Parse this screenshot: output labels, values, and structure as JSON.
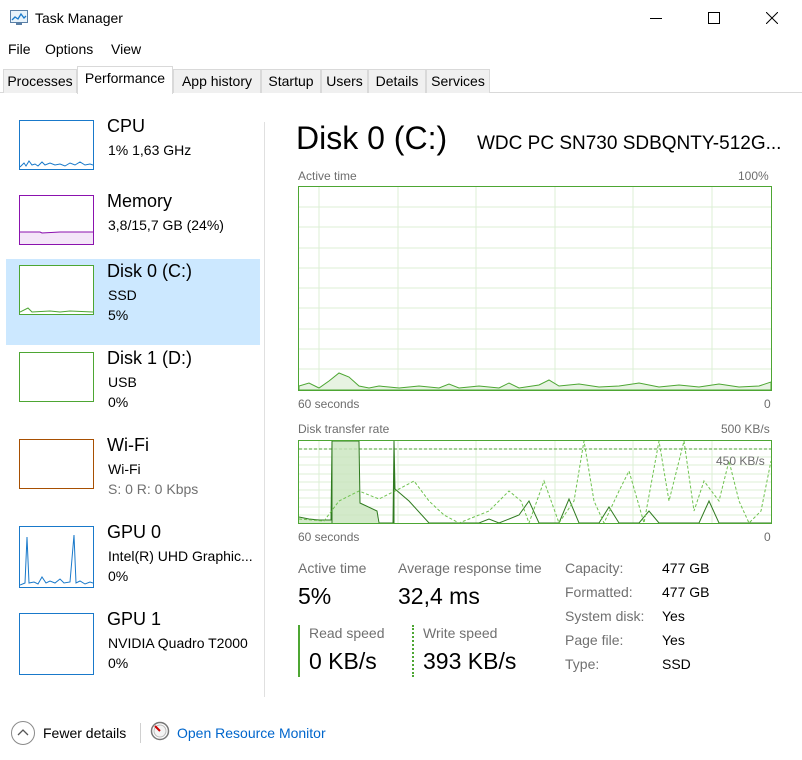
{
  "window": {
    "title": "Task Manager"
  },
  "menu": [
    "File",
    "Options",
    "View"
  ],
  "tabs": [
    "Processes",
    "Performance",
    "App history",
    "Startup",
    "Users",
    "Details",
    "Services"
  ],
  "sidebar": {
    "items": [
      {
        "name": "CPU",
        "line2": "1%  1,63 GHz",
        "line3": "",
        "color": "#1979ca"
      },
      {
        "name": "Memory",
        "line2": "3,8/15,7 GB (24%)",
        "line3": "",
        "color": "#8b12ae"
      },
      {
        "name": "Disk 0 (C:)",
        "line2": "SSD",
        "line3": "5%",
        "color": "#4da633"
      },
      {
        "name": "Disk 1 (D:)",
        "line2": "USB",
        "line3": "0%",
        "color": "#4da633"
      },
      {
        "name": "Wi-Fi",
        "line2": "Wi-Fi",
        "line3": "S: 0  R: 0 Kbps",
        "color": "#a74f01"
      },
      {
        "name": "GPU 0",
        "line2": "Intel(R) UHD Graphic...",
        "line3": "0%",
        "color": "#1979ca"
      },
      {
        "name": "GPU 1",
        "line2": "NVIDIA Quadro T2000",
        "line3": "0%",
        "color": "#1979ca"
      }
    ]
  },
  "main": {
    "title": "Disk 0 (C:)",
    "model": "WDC PC SN730 SDBQNTY-512G...",
    "active_graph": {
      "label": "Active time",
      "max": "100%",
      "time": "60 seconds",
      "min": "0"
    },
    "transfer_graph": {
      "label": "Disk transfer rate",
      "max": "500 KB/s",
      "inner": "450 KB/s",
      "time": "60 seconds",
      "min": "0"
    },
    "stats": {
      "active_time_label": "Active time",
      "active_time_value": "5%",
      "avg_resp_label": "Average response time",
      "avg_resp_value": "32,4 ms",
      "read_label": "Read speed",
      "read_value": "0 KB/s",
      "write_label": "Write speed",
      "write_value": "393 KB/s"
    },
    "properties": [
      {
        "label": "Capacity:",
        "value": "477 GB"
      },
      {
        "label": "Formatted:",
        "value": "477 GB"
      },
      {
        "label": "System disk:",
        "value": "Yes"
      },
      {
        "label": "Page file:",
        "value": "Yes"
      },
      {
        "label": "Type:",
        "value": "SSD"
      }
    ]
  },
  "footer": {
    "fewer_details": "Fewer details",
    "open_monitor": "Open Resource Monitor"
  },
  "colors": {
    "disk": "#4da633",
    "selected": "#cce8ff",
    "cpu": "#1979ca",
    "memory": "#8b12ae",
    "wifi": "#a74f01"
  }
}
